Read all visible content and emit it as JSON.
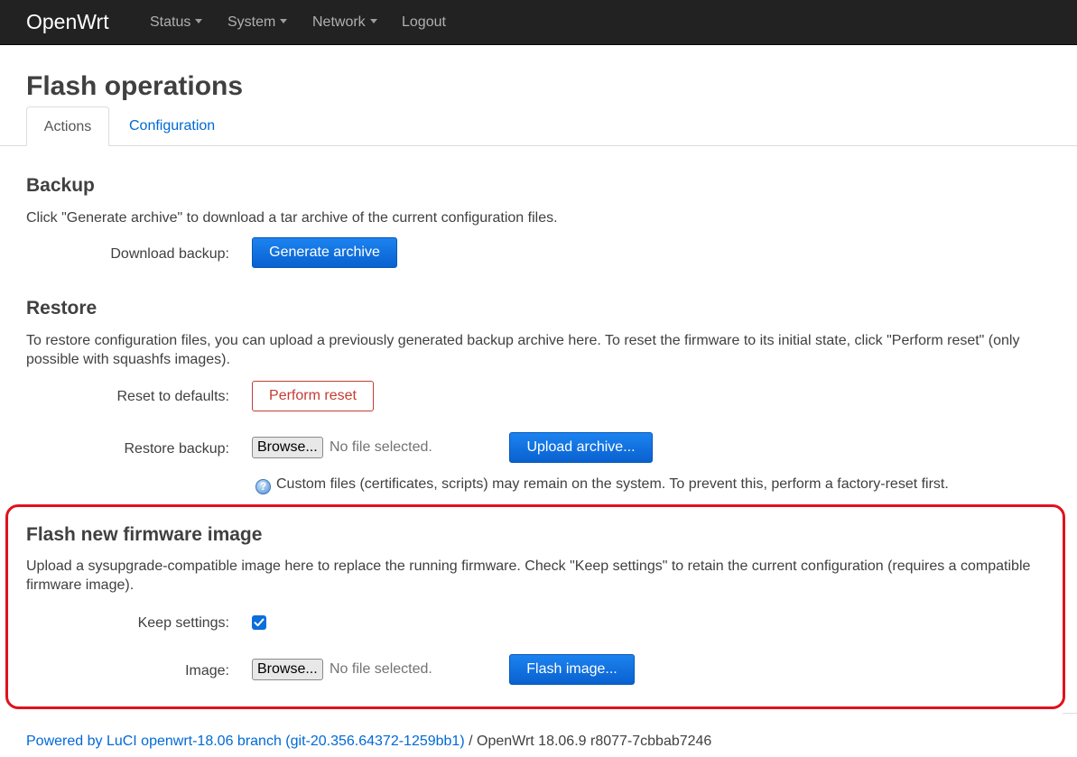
{
  "header": {
    "brand": "OpenWrt",
    "menu": [
      {
        "label": "Status",
        "dropdown": true
      },
      {
        "label": "System",
        "dropdown": true
      },
      {
        "label": "Network",
        "dropdown": true
      },
      {
        "label": "Logout",
        "dropdown": false
      }
    ]
  },
  "page": {
    "title": "Flash operations",
    "tabs": [
      {
        "label": "Actions",
        "active": true
      },
      {
        "label": "Configuration",
        "active": false
      }
    ]
  },
  "backup": {
    "heading": "Backup",
    "description": "Click \"Generate archive\" to download a tar archive of the current configuration files.",
    "download_label": "Download backup:",
    "generate_button": "Generate archive"
  },
  "restore": {
    "heading": "Restore",
    "description": "To restore configuration files, you can upload a previously generated backup archive here. To reset the firmware to its initial state, click \"Perform reset\" (only possible with squashfs images).",
    "reset_label": "Reset to defaults:",
    "reset_button": "Perform reset",
    "restore_label": "Restore backup:",
    "browse_button": "Browse...",
    "file_status": "No file selected.",
    "upload_button": "Upload archive...",
    "hint": "Custom files (certificates, scripts) may remain on the system. To prevent this, perform a factory-reset first."
  },
  "flash": {
    "heading": "Flash new firmware image",
    "description": "Upload a sysupgrade-compatible image here to replace the running firmware. Check \"Keep settings\" to retain the current configuration (requires a compatible firmware image).",
    "keep_label": "Keep settings:",
    "keep_checked": true,
    "image_label": "Image:",
    "browse_button": "Browse...",
    "file_status": "No file selected.",
    "flash_button": "Flash image..."
  },
  "footer": {
    "link_text": "Powered by LuCI openwrt-18.06 branch (git-20.356.64372-1259bb1)",
    "version_text": " / OpenWrt 18.06.9 r8077-7cbbab7246"
  },
  "colors": {
    "topbar": "#222222",
    "primary_button": "#0b6edb",
    "reset_button": "#c43c35",
    "link": "#0069d6",
    "highlight_box": "#e0121b"
  }
}
